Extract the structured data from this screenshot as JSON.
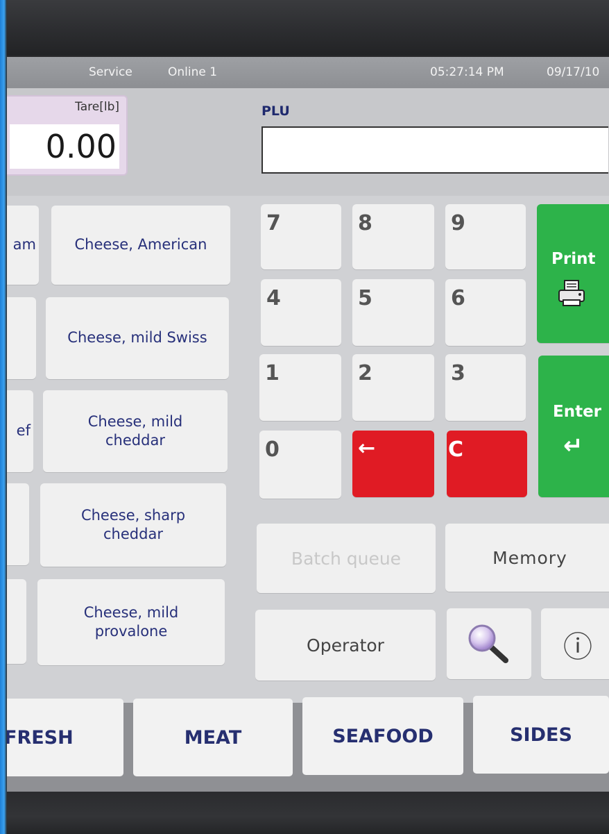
{
  "status_bar": {
    "mode": "Service",
    "connection": "Online 1",
    "time": "05:27:14 PM",
    "date": "09/17/10"
  },
  "tare": {
    "label": "Tare[lb]",
    "value": "0.00"
  },
  "plu": {
    "label": "PLU",
    "value": ""
  },
  "left_column_partial": [
    "am",
    "",
    "ef",
    "",
    ""
  ],
  "plu_buttons": [
    "Cheese, American",
    "Cheese, mild Swiss",
    "Cheese, mild cheddar",
    "Cheese, sharp cheddar",
    "Cheese, mild provalone"
  ],
  "keypad": {
    "digits": [
      "7",
      "8",
      "9",
      "4",
      "5",
      "6",
      "1",
      "2",
      "3",
      "0"
    ],
    "backspace": "←",
    "clear": "C",
    "print": "Print",
    "enter": "Enter",
    "enter_glyph": "↵",
    "print_icon": "printer-icon"
  },
  "actions": {
    "batch_queue": "Batch queue",
    "memory": "Memory",
    "operator": "Operator",
    "search_icon": "magnifier-icon",
    "info_icon": "info-icon",
    "info_glyph": "ⓘ"
  },
  "tabs": [
    "FRESH",
    "MEAT",
    "SEAFOOD",
    "SIDES"
  ],
  "colors": {
    "accent_green": "#2db34a",
    "accent_red": "#e01b24",
    "text_blue": "#27307a",
    "screen_bg": "#d0d1d4",
    "edge_blue": "#2a97ea"
  }
}
